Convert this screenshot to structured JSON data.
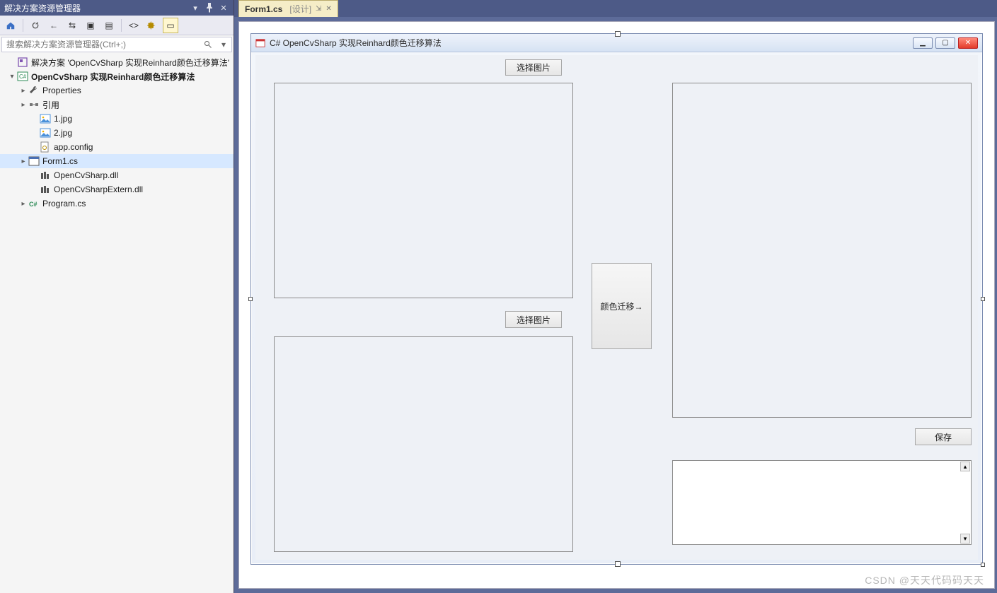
{
  "panel": {
    "title": "解决方案资源管理器",
    "search_placeholder": "搜索解决方案资源管理器(Ctrl+;)"
  },
  "tree": {
    "solution": "解决方案 'OpenCvSharp 实现Reinhard颜色迁移算法'",
    "project": "OpenCvSharp 实现Reinhard颜色迁移算法",
    "properties": "Properties",
    "references": "引用",
    "file_1jpg": "1.jpg",
    "file_2jpg": "2.jpg",
    "appconfig": "app.config",
    "form1": "Form1.cs",
    "dll1": "OpenCvSharp.dll",
    "dll2": "OpenCvSharpExtern.dll",
    "program": "Program.cs"
  },
  "tab": {
    "label": "Form1.cs",
    "suffix": "[设计]"
  },
  "form": {
    "title": "C# OpenCvSharp 实现Reinhard颜色迁移算法",
    "btn_pick_top": "选择图片",
    "btn_pick_bottom": "选择图片",
    "btn_transfer": "颜色迁移→",
    "btn_save": "保存"
  },
  "watermark": "CSDN @天天代码码天天"
}
